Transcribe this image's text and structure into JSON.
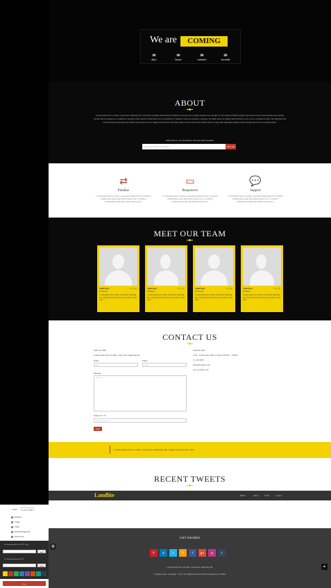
{
  "hero": {
    "we_are": "We are",
    "coming": "COMING",
    "timer": [
      {
        "n": "00",
        "l": "days"
      },
      {
        "n": "00",
        "l": "hours"
      },
      {
        "n": "00",
        "l": "minutes"
      },
      {
        "n": "00",
        "l": "seconds"
      }
    ]
  },
  "about": {
    "title": "ABOUT",
    "text": "Lorem ipsum dolor sit amet, consectetur adipiscing elit. Sed diam nonummy nibh euismod tincidunt ut laoreet dolore magna aliquam erat volutpat. Ut wisi enim ad minim veniam, quis nostrud exerci tation ullamcorper suscipit lobortis nisl ut aliquip ex ea commodo consequat. Duis autem vel eum iriure dolor in hendrerit in vulputate velit esse molestie consequat, vel illum dolore eu feugiat nulla facilisis at vero eros et accumsan et iusto odio dignissim qui blandit praesent luptatum zzril delenit augue duis dolore te feugait nulla facilisi. Nam liber tempor cum soluta nobis eleifend option congue nihil imperdiet doming id quod mazim placerat facer possim assum.",
    "subscribe_label": "Subscribe to our newsletter and get latest updates",
    "subscribe_placeholder": "enter your e-mail to subscribe",
    "subscribe_button": "Subscribe"
  },
  "features": [
    {
      "icon": "shuffle-icon",
      "glyph": "⇄",
      "title": "Parallax",
      "desc": "Lorem ipsum dolor sit amet, consectetur adipiscing elit. Curabitur pellentesque neque eget diam posuere porta. Curabitur pellentesque neque eget diam posuere porta."
    },
    {
      "icon": "monitor-icon",
      "glyph": "▭",
      "title": "Responsive",
      "desc": "Lorem ipsum dolor sit amet, consectetur adipiscing elit. Curabitur pellentesque neque eget diam posuere porta. Curabitur pellentesque neque eget diam posuere porta."
    },
    {
      "icon": "chat-icon",
      "glyph": "💬",
      "title": "Support",
      "desc": "Lorem ipsum dolor sit amet, consectetur adipiscing elit. Curabitur pellentesque neque eget diam posuere porta. Curabitur pellentesque neque eget diam posuere porta."
    }
  ],
  "team": {
    "title": "MEET OUR TEAM",
    "members": [
      {
        "name": "John Doe",
        "role": "Developer",
        "text": "Lorem ipsum dolor sit amet, consectetur adipiscing elit. Curabitur pellentesque neque eget diam posuere porta."
      },
      {
        "name": "Jane Doe",
        "role": "Designer",
        "text": "Lorem ipsum dolor sit amet, consectetur adipiscing elit. Curabitur pellentesque neque eget diam posuere porta."
      },
      {
        "name": "John Doe",
        "role": "Developer",
        "text": "Lorem ipsum dolor sit amet, consectetur adipiscing elit. Curabitur pellentesque neque eget diam posuere porta."
      },
      {
        "name": "Jane Doe",
        "role": "Designer",
        "text": "Lorem ipsum dolor sit amet, consectetur adipiscing elit. Curabitur pellentesque neque eget diam posuere porta."
      }
    ],
    "social": "f  t  g+  in"
  },
  "contact": {
    "title": "CONTACT US",
    "send_mail": "Send us mail",
    "intro": "Lorem ipsum dolor sit amet, consectetur adipiscing elit.",
    "name_label": "Name",
    "name_ph": "Name",
    "email_label": "Email",
    "email_ph": "Email",
    "message_label": "Message",
    "message_ph": "Message",
    "captcha_label": "What is 6 + 8 ?",
    "captcha_ph": "Type your answer",
    "send_button": "Send",
    "address_title": "Address Info",
    "address": "1234 - 12345 street name, London, UK Box - 123456",
    "phone": "+1 234 5678",
    "email": "hello@yoursite.com",
    "web": "www.yoursite.com"
  },
  "quote": "Lorem ipsum dolor sit amet, consectetur adipiscing elit. Integer posuere erat a ante.",
  "tweets": {
    "title": "RECENT TWEETS"
  },
  "nav": {
    "logo": "Landlite",
    "items": [
      "Home",
      "About",
      "Team",
      "Contact"
    ]
  },
  "footer": {
    "title": "Let's Socialize",
    "icons": [
      {
        "name": "pinterest-icon",
        "g": "P",
        "c": "#cb2027"
      },
      {
        "name": "linkedin-icon",
        "g": "in",
        "c": "#007bb6"
      },
      {
        "name": "vimeo-icon",
        "g": "v",
        "c": "#1ab7ea"
      },
      {
        "name": "rss-icon",
        "g": "R",
        "c": "#f39c12"
      },
      {
        "name": "facebook-icon",
        "g": "f",
        "c": "#3b5998"
      },
      {
        "name": "googleplus-icon",
        "g": "g+",
        "c": "#dd4b39"
      },
      {
        "name": "instagram-icon",
        "g": "◎",
        "c": "#c13584"
      },
      {
        "name": "tumblr-icon",
        "g": "t",
        "c": "#35465c"
      }
    ],
    "tagline": "Lorem ipsum dolor sit amet, consectetur adipiscing elit.",
    "copyright": "Company name. Copyright © 2013. All Rights Reserved. Theme Template by Landlite"
  },
  "panel": {
    "font_label": "Fonts",
    "font_a": "Aa",
    "font_b": "Off",
    "options": [
      "Parallax",
      "Vimeo",
      "Video",
      "Fixed Background",
      "Solid Color"
    ],
    "bg_color_label": "Set Background Color / HEX / rgb",
    "bg_image_label": "Set Background Image URL",
    "apply": "apply",
    "reset": "Reset",
    "swatches": [
      "#f2d200",
      "#c0392b",
      "#27ae60",
      "#2980b9",
      "#8e44ad",
      "#d35400",
      "#16a085",
      "#2c3e50"
    ]
  }
}
